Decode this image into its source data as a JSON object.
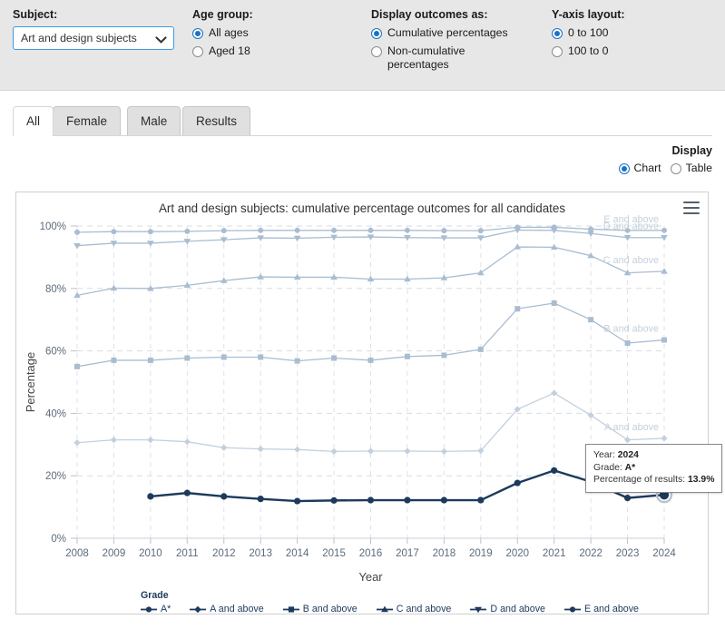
{
  "filters": {
    "subject": {
      "label": "Subject:",
      "value": "Art and design subjects",
      "options": [
        "Art and design subjects"
      ],
      "icon": "chevron-down-icon"
    },
    "age_group": {
      "label": "Age group:",
      "options": [
        {
          "label": "All ages",
          "checked": true
        },
        {
          "label": "Aged 18",
          "checked": false
        }
      ]
    },
    "display_outcomes": {
      "label": "Display outcomes as:",
      "options": [
        {
          "label": "Cumulative percentages",
          "checked": true
        },
        {
          "label": "Non-cumulative percentages",
          "checked": false
        }
      ]
    },
    "y_axis_layout": {
      "label": "Y-axis layout:",
      "options": [
        {
          "label": "0 to 100",
          "checked": true
        },
        {
          "label": "100 to 0",
          "checked": false
        }
      ]
    }
  },
  "tabs": [
    {
      "label": "All",
      "active": true
    },
    {
      "label": "Female",
      "active": false
    },
    {
      "label": "Male",
      "active": false
    },
    {
      "label": "Results",
      "active": false
    }
  ],
  "display": {
    "title": "Display",
    "options": [
      {
        "label": "Chart",
        "checked": true
      },
      {
        "label": "Table",
        "checked": false
      }
    ]
  },
  "chart_panel": {
    "menu_icon": "hamburger-menu-icon"
  },
  "tooltip": {
    "year_label": "Year:",
    "year_value": "2024",
    "grade_label": "Grade:",
    "grade_value": "A*",
    "pct_label": "Percentage of results:",
    "pct_value": "13.9%"
  },
  "legend": {
    "title": "Grade",
    "items": [
      {
        "label": "A*",
        "marker": "circle",
        "color": "#1d3a5c"
      },
      {
        "label": "A and above",
        "marker": "diamond",
        "color": "#1d3a5c"
      },
      {
        "label": "B and above",
        "marker": "square",
        "color": "#1d3a5c"
      },
      {
        "label": "C and above",
        "marker": "triangle",
        "color": "#1d3a5c"
      },
      {
        "label": "D and above",
        "marker": "triangle-down",
        "color": "#1d3a5c"
      },
      {
        "label": "E and above",
        "marker": "circle",
        "color": "#1d3a5c"
      }
    ]
  },
  "chart_data": {
    "type": "line",
    "title": "Art and design subjects: cumulative percentage outcomes for all candidates",
    "xlabel": "Year",
    "ylabel": "Percentage",
    "x": [
      2008,
      2009,
      2010,
      2011,
      2012,
      2013,
      2014,
      2015,
      2016,
      2017,
      2018,
      2019,
      2020,
      2021,
      2022,
      2023,
      2024
    ],
    "categories": [
      "2008",
      "2009",
      "2010",
      "2011",
      "2012",
      "2013",
      "2014",
      "2015",
      "2016",
      "2017",
      "2018",
      "2019",
      "2020",
      "2021",
      "2022",
      "2023",
      "2024"
    ],
    "ylim": [
      0,
      100
    ],
    "ytick_labels": [
      "0%",
      "20%",
      "40%",
      "60%",
      "80%",
      "100%"
    ],
    "yticks": [
      0,
      20,
      40,
      60,
      80,
      100
    ],
    "grid": true,
    "legend_position": "bottom",
    "highlight_point": {
      "x": 2024,
      "y": 13.9,
      "series": "A*",
      "label": "A*"
    },
    "series": [
      {
        "name": "E and above",
        "label_right": "E and above",
        "color": "#a9bdd1",
        "marker": "circle",
        "values": [
          98.0,
          98.2,
          98.2,
          98.3,
          98.5,
          98.6,
          98.6,
          98.6,
          98.6,
          98.6,
          98.5,
          98.5,
          99.6,
          99.6,
          99.0,
          98.6,
          98.6
        ]
      },
      {
        "name": "D and above",
        "label_right": "D and above",
        "color": "#a9bdd1",
        "marker": "triangle-down",
        "values": [
          93.7,
          94.5,
          94.5,
          95.1,
          95.6,
          96.2,
          96.1,
          96.4,
          96.5,
          96.3,
          96.2,
          96.2,
          98.7,
          98.6,
          97.6,
          96.3,
          96.3
        ]
      },
      {
        "name": "C and above",
        "label_right": "C and above",
        "color": "#a9bdd1",
        "marker": "triangle",
        "values": [
          77.8,
          80.1,
          80.0,
          81.0,
          82.5,
          83.7,
          83.6,
          83.6,
          83.0,
          83.0,
          83.4,
          85.0,
          93.3,
          93.2,
          90.5,
          85.0,
          85.5
        ]
      },
      {
        "name": "B and above",
        "label_right": "B and above",
        "color": "#a9bdd1",
        "marker": "square",
        "values": [
          55.0,
          57.0,
          57.0,
          57.7,
          58.0,
          58.0,
          56.8,
          57.7,
          57.0,
          58.2,
          58.6,
          60.5,
          73.5,
          75.3,
          70.0,
          62.5,
          63.5
        ]
      },
      {
        "name": "A and above",
        "label_right": "A and above",
        "color": "#c3d0de",
        "marker": "diamond",
        "values": [
          30.6,
          31.5,
          31.5,
          30.9,
          29.0,
          28.6,
          28.4,
          27.8,
          27.9,
          27.9,
          27.8,
          28.0,
          41.3,
          46.5,
          39.4,
          31.5,
          32.0
        ]
      },
      {
        "name": "A*",
        "label_right": "A*",
        "color": "#1d3a5c",
        "marker": "circle",
        "values": [
          null,
          null,
          13.4,
          14.5,
          13.4,
          12.6,
          11.9,
          12.1,
          12.2,
          12.2,
          12.2,
          12.2,
          17.7,
          21.7,
          18.1,
          12.9,
          13.9
        ]
      }
    ]
  }
}
